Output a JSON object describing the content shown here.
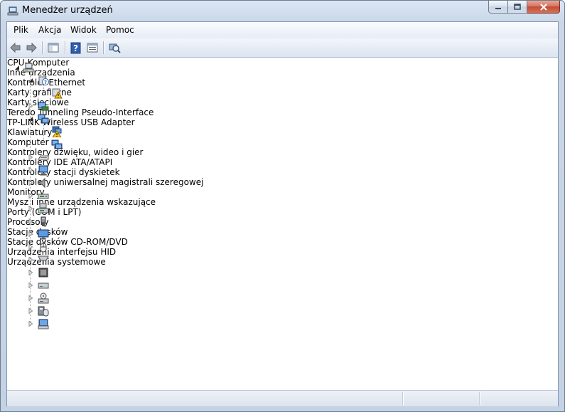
{
  "window": {
    "title": "Menedżer urządzeń",
    "title_icon": "device-manager-icon"
  },
  "menu": {
    "items": [
      "Plik",
      "Akcja",
      "Widok",
      "Pomoc"
    ]
  },
  "toolbar": {
    "buttons": [
      "back-arrow-icon",
      "forward-arrow-icon",
      "show-hide-console-tree-icon",
      "help-icon",
      "properties-icon",
      "scan-hardware-icon"
    ]
  },
  "tree": {
    "root": "CPU-Komputer",
    "nodes": [
      {
        "label": "Inne urządzenia",
        "expanded": true,
        "icon": "unknown-device-icon",
        "children": [
          {
            "label": "Kontroler Ethernet",
            "icon": "warning-device-icon"
          }
        ]
      },
      {
        "label": "Karty graficzne",
        "expanded": false,
        "icon": "display-adapter-icon"
      },
      {
        "label": "Karty sieciowe",
        "expanded": true,
        "icon": "network-adapter-icon",
        "children": [
          {
            "label": "Teredo Tunneling Pseudo-Interface",
            "icon": "warning-network-icon"
          },
          {
            "label": "TP-LINK Wireless USB Adapter",
            "icon": "network-adapter-icon"
          }
        ]
      },
      {
        "label": "Klawiatury",
        "expanded": false,
        "icon": "keyboard-icon"
      },
      {
        "label": "Komputer",
        "expanded": false,
        "icon": "computer-icon"
      },
      {
        "label": "Kontrolery dźwięku, wideo i gier",
        "expanded": false,
        "icon": "speaker-icon"
      },
      {
        "label": "Kontrolery IDE ATA/ATAPI",
        "expanded": false,
        "icon": "ide-controller-icon"
      },
      {
        "label": "Kontrolery stacji dyskietek",
        "expanded": false,
        "icon": "floppy-controller-icon"
      },
      {
        "label": "Kontrolery uniwersalnej magistrali szeregowej",
        "expanded": false,
        "icon": "usb-controller-icon"
      },
      {
        "label": "Monitory",
        "expanded": false,
        "icon": "monitor-icon"
      },
      {
        "label": "Mysz i inne urządzenia wskazujące",
        "expanded": false,
        "icon": "mouse-icon"
      },
      {
        "label": "Porty (COM i LPT)",
        "expanded": false,
        "icon": "port-icon"
      },
      {
        "label": "Procesory",
        "expanded": false,
        "icon": "processor-icon"
      },
      {
        "label": "Stacje dysków",
        "expanded": false,
        "icon": "disk-drive-icon"
      },
      {
        "label": "Stacje dysków CD-ROM/DVD",
        "expanded": false,
        "icon": "cdrom-drive-icon"
      },
      {
        "label": "Urządzenia interfejsu HID",
        "expanded": false,
        "icon": "hid-device-icon"
      },
      {
        "label": "Urządzenia systemowe",
        "expanded": false,
        "icon": "system-device-icon"
      }
    ]
  },
  "colors": {
    "titlebar": "#c9d7e8",
    "close_button": "#c44b32",
    "warning": "#f5c518"
  }
}
